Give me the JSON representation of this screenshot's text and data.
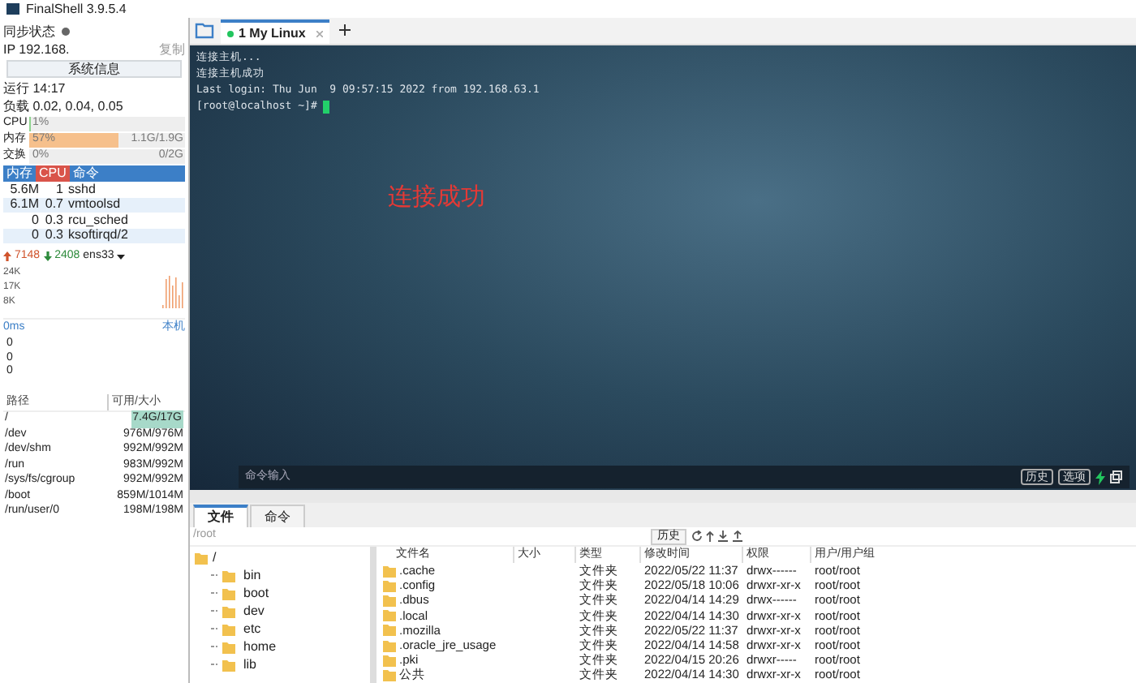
{
  "window": {
    "title": "FinalShell 3.9.5.4"
  },
  "sidebar": {
    "sync_label": "同步状态",
    "ip": "IP 192.168.",
    "copy": "复制",
    "sysinfo_button": "系统信息",
    "uptime": "运行 14:17",
    "load": "负载 0.02, 0.04, 0.05",
    "meters": [
      {
        "label": "CPU",
        "reading": "1%",
        "level": 0.01
      },
      {
        "label": "内存",
        "reading": "57%",
        "level": 0.57,
        "total": "1.1G/1.9G"
      },
      {
        "label": "交换",
        "reading": "0%",
        "level": 0,
        "total": "0/2G"
      }
    ],
    "process_tabs": [
      {
        "label": "内存",
        "selected": false
      },
      {
        "label": "CPU",
        "selected": true
      },
      {
        "label": "命令",
        "selected": false
      }
    ],
    "processes": [
      {
        "mem": "5.6M",
        "cpu": "1",
        "cmd": "sshd"
      },
      {
        "mem": "6.1M",
        "cpu": "0.7",
        "cmd": "vmtoolsd"
      },
      {
        "mem": "0",
        "cpu": "0.3",
        "cmd": "rcu_sched"
      },
      {
        "mem": "0",
        "cpu": "0.3",
        "cmd": "ksoftirqd/2"
      }
    ],
    "network": {
      "up": "7148",
      "down": "2408",
      "interface": "ens33",
      "scale": [
        "24K",
        "17K",
        "8K"
      ]
    },
    "ping": {
      "latency": "0ms",
      "host": "本机",
      "values": [
        "0",
        "0",
        "0"
      ]
    },
    "disk_columns": [
      "路径",
      "可用/大小"
    ],
    "disks": [
      {
        "path": "/",
        "size": "7.4G/17G",
        "selected": true
      },
      {
        "path": "/dev",
        "size": "976M/976M",
        "selected": false
      },
      {
        "path": "/dev/shm",
        "size": "992M/992M",
        "selected": false
      },
      {
        "path": "/run",
        "size": "983M/992M",
        "selected": false
      },
      {
        "path": "/sys/fs/cgroup",
        "size": "992M/992M",
        "selected": false
      },
      {
        "path": "/boot",
        "size": "859M/1014M",
        "selected": false
      },
      {
        "path": "/run/user/0",
        "size": "198M/198M",
        "selected": false
      }
    ]
  },
  "session_tabs": [
    {
      "label": "1 My Linux",
      "selected": true
    }
  ],
  "terminal": {
    "lines": [
      "连接主机...",
      "连接主机成功",
      "Last login: Thu Jun  9 09:57:15 2022 from 192.168.63.1",
      "[root@localhost ~]# "
    ],
    "overlay_text": "连接成功",
    "command_placeholder": "命令输入",
    "buttons": [
      "历史",
      "选项"
    ]
  },
  "bottom": {
    "tabs": [
      {
        "label": "文件",
        "selected": true
      },
      {
        "label": "命令",
        "selected": false
      }
    ],
    "path": "/root",
    "history_button": "历史",
    "tree": {
      "name": "/",
      "children": [
        {
          "name": "bin"
        },
        {
          "name": "boot"
        },
        {
          "name": "dev"
        },
        {
          "name": "etc"
        },
        {
          "name": "home"
        },
        {
          "name": "lib"
        }
      ]
    },
    "columns": [
      "文件名",
      "大小",
      "类型",
      "修改时间",
      "权限",
      "用户/用户组"
    ],
    "files": [
      {
        "name": ".cache",
        "type": "文件夹",
        "modified": "2022/05/22 11:37",
        "permissions": "drwx------",
        "owner": "root/root"
      },
      {
        "name": ".config",
        "type": "文件夹",
        "modified": "2022/05/18 10:06",
        "permissions": "drwxr-xr-x",
        "owner": "root/root"
      },
      {
        "name": ".dbus",
        "type": "文件夹",
        "modified": "2022/04/14 14:29",
        "permissions": "drwx------",
        "owner": "root/root"
      },
      {
        "name": ".local",
        "type": "文件夹",
        "modified": "2022/04/14 14:30",
        "permissions": "drwxr-xr-x",
        "owner": "root/root"
      },
      {
        "name": ".mozilla",
        "type": "文件夹",
        "modified": "2022/05/22 11:37",
        "permissions": "drwxr-xr-x",
        "owner": "root/root"
      },
      {
        "name": ".oracle_jre_usage",
        "type": "文件夹",
        "modified": "2022/04/14 14:58",
        "permissions": "drwxr-xr-x",
        "owner": "root/root"
      },
      {
        "name": ".pki",
        "type": "文件夹",
        "modified": "2022/04/15 20:26",
        "permissions": "drwxr-----",
        "owner": "root/root"
      },
      {
        "name": "公共",
        "type": "文件夹",
        "modified": "2022/04/14 14:30",
        "permissions": "drwxr-xr-x",
        "owner": "root/root"
      }
    ]
  }
}
